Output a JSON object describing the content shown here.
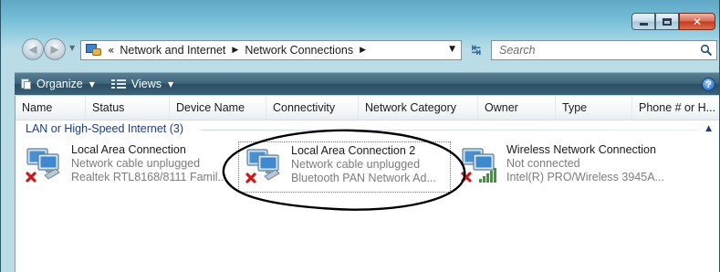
{
  "window": {
    "caption_buttons": {
      "minimize_icon": "minimize-icon",
      "maximize_icon": "maximize-icon",
      "close_icon": "close-icon",
      "close_glyph": "✕"
    }
  },
  "navigation": {
    "back_icon": "back-arrow-icon",
    "forward_icon": "forward-arrow-icon",
    "back_glyph": "◀",
    "forward_glyph": "▶",
    "recent_glyph": "▼"
  },
  "address": {
    "chevrons": "«",
    "crumbs": [
      "Network and Internet",
      "Network Connections"
    ],
    "separator": "▶",
    "dropdown_glyph": "▼"
  },
  "refresh": {
    "glyph": "↹"
  },
  "search": {
    "placeholder": "Search"
  },
  "toolbar": {
    "organize_label": "Organize",
    "views_label": "Views",
    "arrow": "▼",
    "help_label": "?"
  },
  "columns": [
    "Name",
    "Status",
    "Device Name",
    "Connectivity",
    "Network Category",
    "Owner",
    "Type",
    "Phone # or H..."
  ],
  "group": {
    "label": "LAN or High-Speed Internet (3)",
    "collapse_glyph": "▲"
  },
  "connections": [
    {
      "name": "Local Area Connection",
      "status": "Network cable unplugged",
      "device": "Realtek RTL8168/8111 Famil...",
      "type": "wired-disconnected",
      "icon": "network-connection-icon"
    },
    {
      "name": "Local Area Connection 2",
      "status": "Network cable unplugged",
      "device": "Bluetooth PAN Network Ad...",
      "type": "wired-disconnected",
      "icon": "network-connection-icon"
    },
    {
      "name": "Wireless Network Connection",
      "status": "Not connected",
      "device": "Intel(R) PRO/Wireless 3945A...",
      "type": "wireless-disconnected",
      "icon": "wireless-connection-icon"
    }
  ],
  "colors": {
    "group_header": "#1e3d80",
    "toolbar_dark": "#2a4d62",
    "status_gray": "#7c7c7c",
    "disconnected_red": "#d01818",
    "signal_green": "#2ea02e"
  }
}
